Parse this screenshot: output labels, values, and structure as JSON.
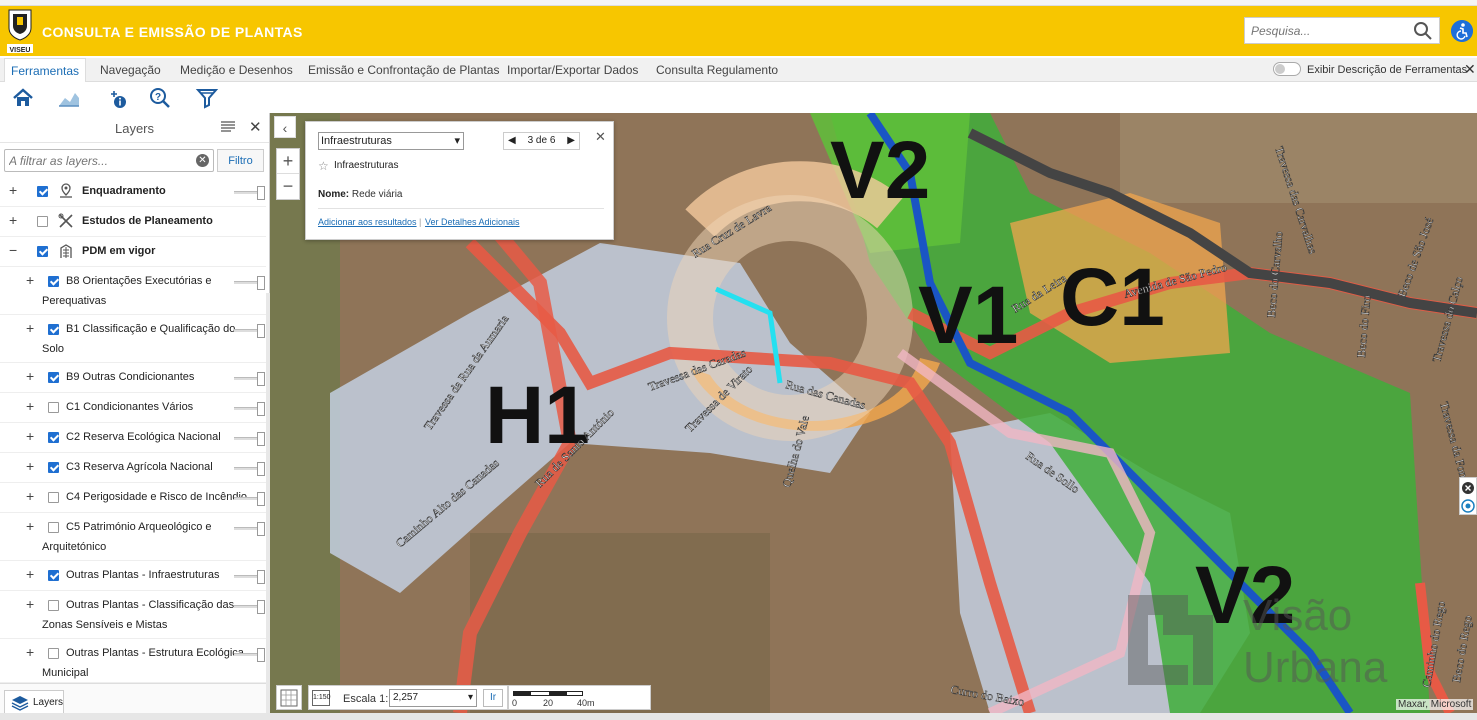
{
  "header": {
    "title": "CONSULTA E EMISSÃO DE PLANTAS",
    "logo_text": "VISEU",
    "search_placeholder": "Pesquisa...",
    "brand_color": "#f7c600"
  },
  "menu": {
    "tabs": [
      {
        "label": "Ferramentas",
        "active": true
      },
      {
        "label": "Navegação"
      },
      {
        "label": "Medição e Desenhos"
      },
      {
        "label": "Emissão e Confrontação de Plantas"
      },
      {
        "label": "Importar/Exportar Dados"
      },
      {
        "label": "Consulta Regulamento"
      }
    ],
    "toggle_label": "Exibir Descrição de Ferramentas"
  },
  "toolbar": {
    "icons": [
      "home-icon",
      "layers-chart-icon",
      "add-info-icon",
      "help-search-icon",
      "filter-icon"
    ]
  },
  "panel": {
    "title": "Layers",
    "filter_placeholder": "A filtrar as layers...",
    "filter_button": "Filtro",
    "bottom_tab": "Layers",
    "layers": [
      {
        "label": "Enquadramento",
        "checked": true,
        "top_level": true
      },
      {
        "label": "Estudos de Planeamento",
        "checked": false,
        "top_level": true
      },
      {
        "label": "PDM em vigor",
        "checked": true,
        "top_level": true,
        "expanded": true
      },
      {
        "label": "B8 Orientações Executórias e",
        "label2": "Perequativas",
        "checked": true
      },
      {
        "label": "B1 Classificação e Qualificação do",
        "label2": "Solo",
        "checked": true
      },
      {
        "label": "B9 Outras Condicionantes",
        "checked": true
      },
      {
        "label": "C1 Condicionantes Vários",
        "checked": false
      },
      {
        "label": "C2 Reserva Ecológica Nacional",
        "checked": true
      },
      {
        "label": "C3 Reserva Agrícola Nacional",
        "checked": true
      },
      {
        "label": "C4 Perigosidade e Risco de Incêndio",
        "checked": false
      },
      {
        "label": "C5 Património Arqueológico e",
        "label2": "Arquitetónico",
        "checked": false
      },
      {
        "label": "Outras Plantas - Infraestruturas",
        "checked": true
      },
      {
        "label": "Outras Plantas - Classificação das",
        "label2": "Zonas Sensíveis e Mistas",
        "checked": false
      },
      {
        "label": "Outras Plantas - Estrutura Ecológica",
        "label2": "Municipal",
        "checked": false
      }
    ]
  },
  "popup": {
    "select_value": "Infraestruturas",
    "pager": "3 de 6",
    "feature_title": "Infraestruturas",
    "name_label": "Nome:",
    "name_value": "Rede viária",
    "link_add": "Adicionar aos resultados",
    "link_sep": "|",
    "link_details": "Ver Detalhes Adicionais"
  },
  "map": {
    "zone_labels": [
      "V2",
      "V1",
      "C1",
      "H1",
      "V2"
    ],
    "streets": [
      "Rua Cruz de Lavra",
      "Travessa da Rua da Aumaria",
      "Travessa das Caradas",
      "Rua das Canadas",
      "Travessa de Virato",
      "Quelha do Vale",
      "Rua de Santo António",
      "Caminho Alto das Canadas",
      "Rua da Leira",
      "Avenida de São Pedro",
      "Travessa das Carvalhas",
      "Beco do Carvalho",
      "Beco do Firo",
      "Beco de São José",
      "Travessa do Calço",
      "Travessa da Fonte",
      "Rua de Sollo",
      "Curro do Baixo",
      "Caminho do Rego",
      "Beco do Rego"
    ],
    "watermark_line1": "Visão",
    "watermark_line2": "Urbana",
    "attribution": "Maxar, Microsoft"
  },
  "scale": {
    "label": "Escala 1:",
    "value": "2,257",
    "go_button": "Ir",
    "tool_label": "1:150",
    "ticks": [
      "0",
      "20",
      "40m"
    ]
  }
}
